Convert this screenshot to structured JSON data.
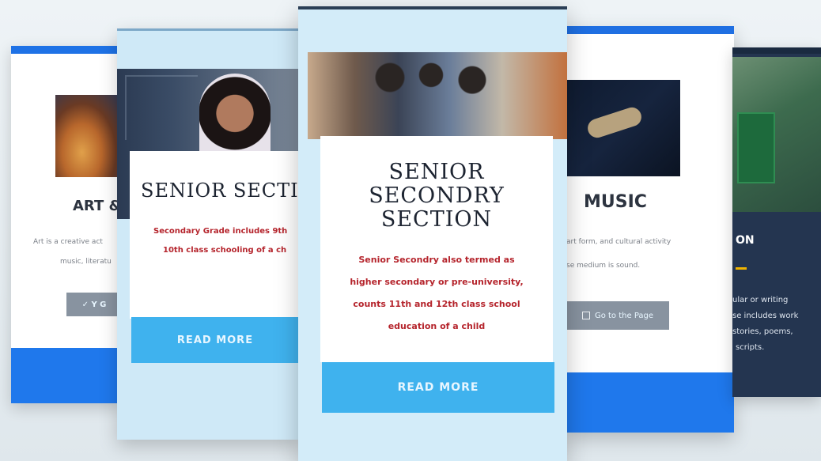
{
  "cards": {
    "art": {
      "title": "ART &",
      "desc_1": "Art is a creative act",
      "desc_2": "music, literatu",
      "button": "✓ Y G"
    },
    "senior": {
      "title": "SENIOR SECTI",
      "desc_1": "Secondary Grade includes 9th",
      "desc_2": "10th class schooling of a ch",
      "button": "READ MORE"
    },
    "senior_secondary": {
      "title_1": "SENIOR",
      "title_2": "SECONDRY",
      "title_3": "SECTION",
      "desc_1": "Senior Secondry also termed as",
      "desc_2": "higher secondary or pre-university,",
      "desc_3": "counts 11th and 12th class school",
      "desc_4": "education of a child",
      "button": "READ MORE"
    },
    "music": {
      "title": "MUSIC",
      "desc_1": "art form, and cultural activity",
      "desc_2": "se medium is sound.",
      "button": "Go to the Page"
    },
    "literature": {
      "title": "ON",
      "desc_1": "ular or writing",
      "desc_2": "se includes work",
      "desc_3": "stories, poems,",
      "desc_4": "scripts."
    }
  },
  "colors": {
    "accent_blue": "#1f78ec",
    "button_light": "#3fb2ee",
    "desc_red": "#b5242c",
    "title_dark": "#1d2431"
  }
}
